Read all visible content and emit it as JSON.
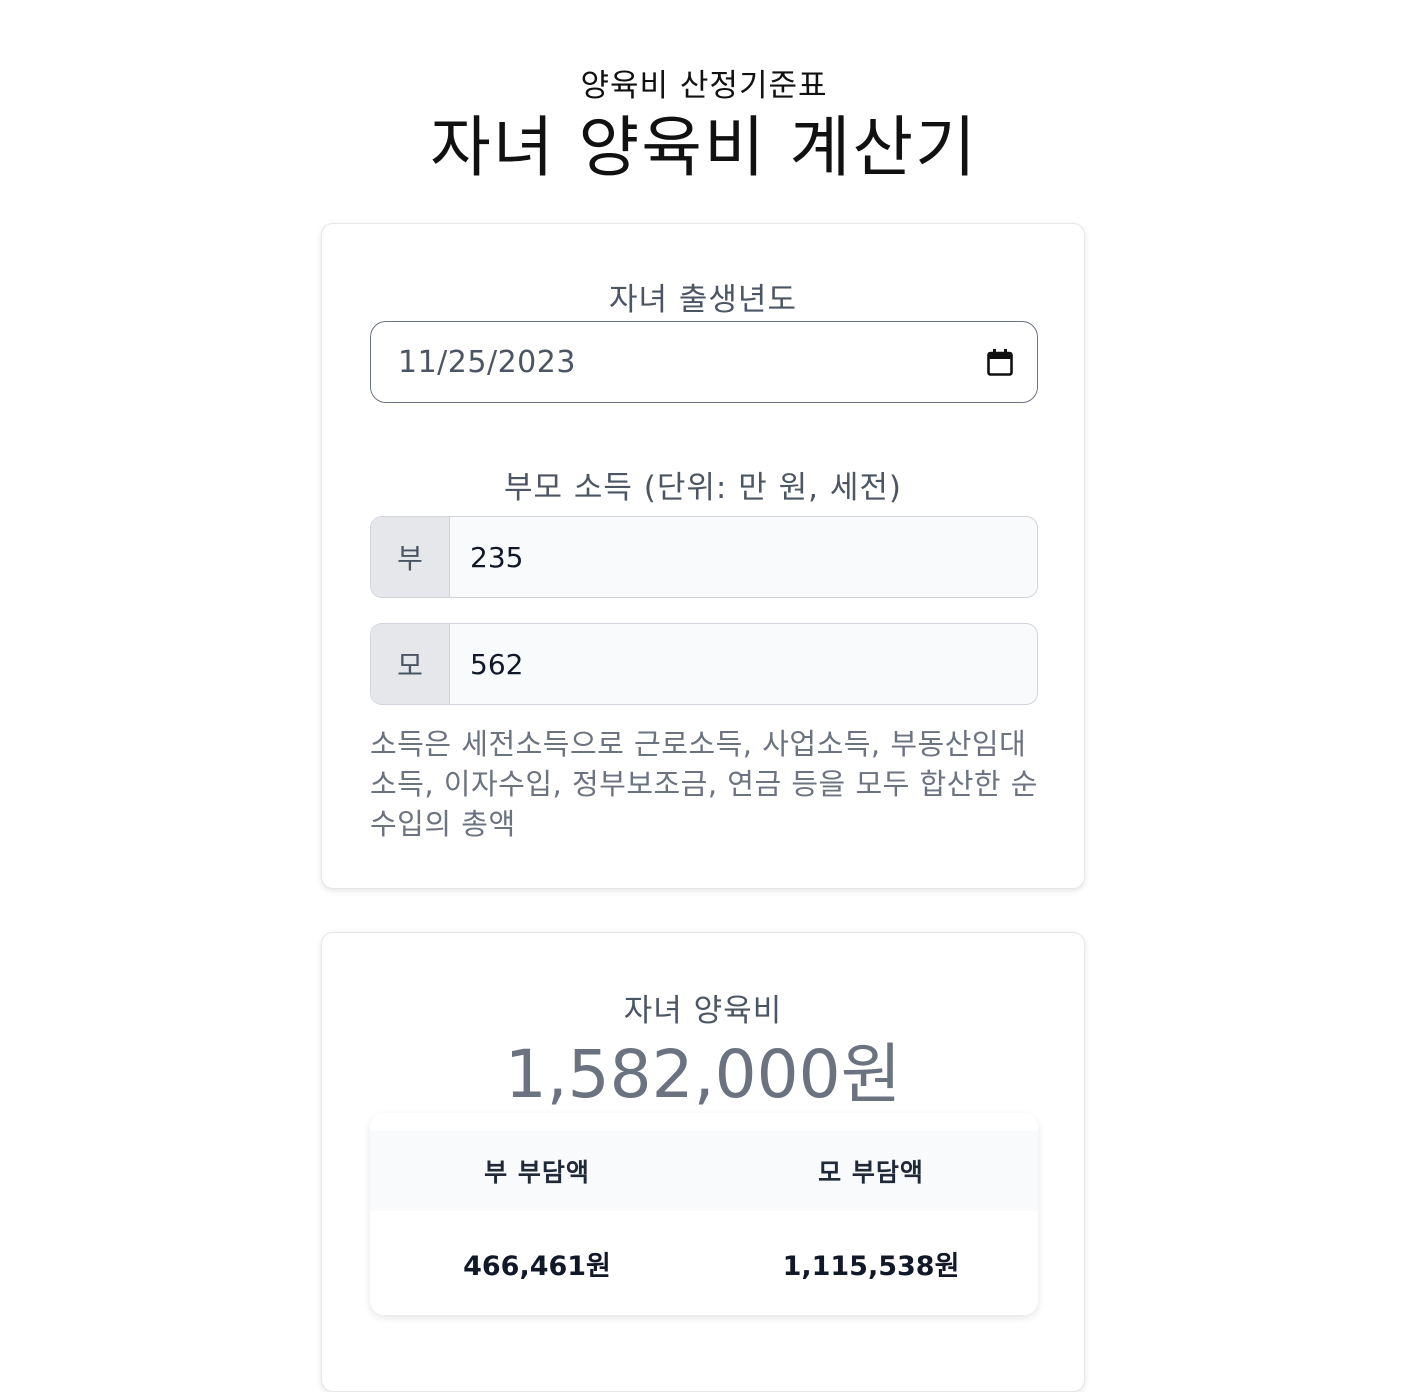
{
  "header": {
    "subtitle": "양육비 산정기준표",
    "title": "자녀 양육비 계산기"
  },
  "birth": {
    "label": "자녀 출생년도",
    "date_value": "11/25/2023",
    "icon": "calendar-icon"
  },
  "income": {
    "label": "부모 소득 (단위: 만 원, 세전)",
    "father": {
      "prefix": "부",
      "value": "235"
    },
    "mother": {
      "prefix": "모",
      "value": "562"
    },
    "help_text": "소득은 세전소득으로 근로소득, 사업소득, 부동산임대소득, 이자수입, 정부보조금, 연금 등을 모두 합산한 순수입의 총액"
  },
  "result": {
    "label": "자녀 양육비",
    "amount": "1,582,000원",
    "table": {
      "headers": [
        "부 부담액",
        "모 부담액"
      ],
      "values": [
        "466,461원",
        "1,115,538원"
      ]
    }
  }
}
